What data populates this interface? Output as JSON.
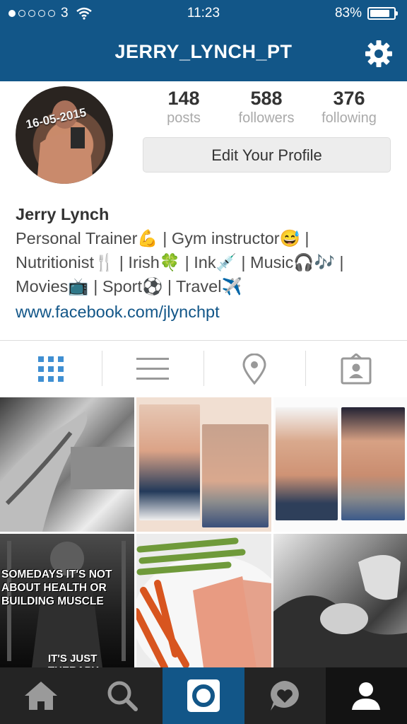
{
  "status": {
    "carrier": "3",
    "time": "11:23",
    "battery": "83%",
    "battery_level": 0.83
  },
  "header": {
    "username": "JERRY_LYNCH_PT"
  },
  "profile": {
    "avatar_date": "16-05-2015",
    "stats": [
      {
        "num": "148",
        "label": "posts"
      },
      {
        "num": "588",
        "label": "followers"
      },
      {
        "num": "376",
        "label": "following"
      }
    ],
    "edit_button": "Edit Your Profile",
    "name": "Jerry Lynch",
    "bio_lines": [
      "Personal Trainer💪 | Gym instructor😅 |",
      "Nutritionist🍴 | Irish🍀 | Ink💉 | Music🎧🎶 |",
      "Movies📺 | Sport⚽ | Travel✈️"
    ],
    "link": "www.facebook.com/jlynchpt"
  },
  "tabs": [
    "grid-view",
    "list-view",
    "location-view",
    "tagged-view"
  ],
  "posts": {
    "quote_top": "SOMEDAYS IT'S NOT ABOUT HEALTH OR BUILDING MUSCLE",
    "quote_bottom": "IT'S JUST THERAPY"
  },
  "bottom_nav": [
    "home",
    "search",
    "camera",
    "activity",
    "profile"
  ],
  "colors": {
    "brand": "#125688",
    "bottom_nav": "#242424"
  }
}
